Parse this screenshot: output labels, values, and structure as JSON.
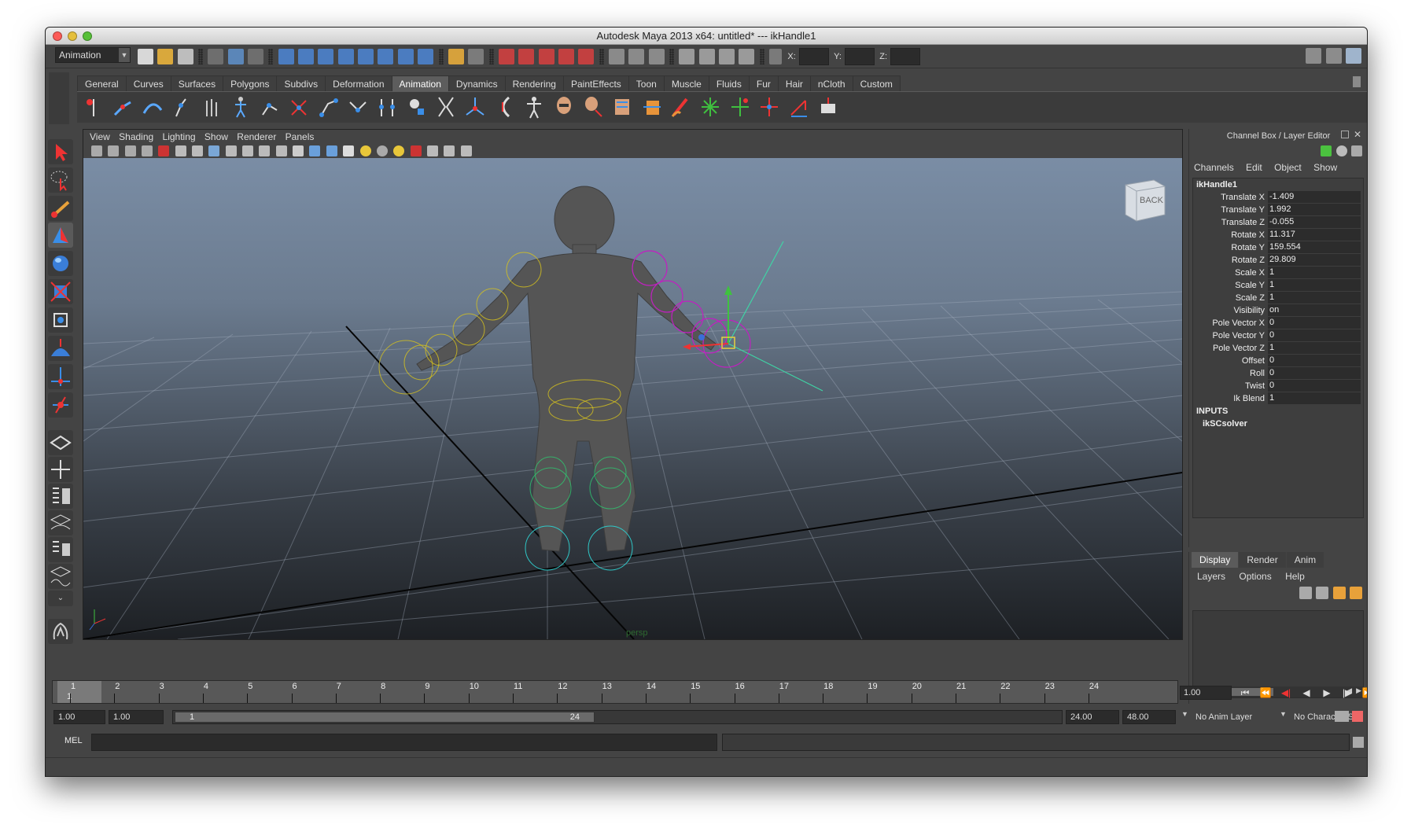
{
  "window": {
    "title": "Autodesk Maya 2013 x64: untitled*   ---   ikHandle1"
  },
  "status_line": {
    "mode_menu": "Animation",
    "x_label": "X:",
    "y_label": "Y:",
    "z_label": "Z:"
  },
  "shelf_tabs": [
    {
      "label": "General"
    },
    {
      "label": "Curves"
    },
    {
      "label": "Surfaces"
    },
    {
      "label": "Polygons"
    },
    {
      "label": "Subdivs"
    },
    {
      "label": "Deformation"
    },
    {
      "label": "Animation",
      "active": true
    },
    {
      "label": "Dynamics"
    },
    {
      "label": "Rendering"
    },
    {
      "label": "PaintEffects"
    },
    {
      "label": "Toon"
    },
    {
      "label": "Muscle"
    },
    {
      "label": "Fluids"
    },
    {
      "label": "Fur"
    },
    {
      "label": "Hair"
    },
    {
      "label": "nCloth"
    },
    {
      "label": "Custom"
    }
  ],
  "viewport": {
    "menu": [
      "View",
      "Shading",
      "Lighting",
      "Show",
      "Renderer",
      "Panels"
    ],
    "camera_label": "persp",
    "viewcube_label": "BACK"
  },
  "channel_box": {
    "header": "Channel Box / Layer Editor",
    "menu": [
      "Channels",
      "Edit",
      "Object",
      "Show"
    ],
    "object_name": "ikHandle1",
    "channels": [
      {
        "label": "Translate X",
        "value": "-1.409"
      },
      {
        "label": "Translate Y",
        "value": "1.992"
      },
      {
        "label": "Translate Z",
        "value": "-0.055"
      },
      {
        "label": "Rotate X",
        "value": "11.317"
      },
      {
        "label": "Rotate Y",
        "value": "159.554"
      },
      {
        "label": "Rotate Z",
        "value": "29.809"
      },
      {
        "label": "Scale X",
        "value": "1"
      },
      {
        "label": "Scale Y",
        "value": "1"
      },
      {
        "label": "Scale Z",
        "value": "1"
      },
      {
        "label": "Visibility",
        "value": "on"
      },
      {
        "label": "Pole Vector X",
        "value": "0"
      },
      {
        "label": "Pole Vector Y",
        "value": "0"
      },
      {
        "label": "Pole Vector Z",
        "value": "1"
      },
      {
        "label": "Offset",
        "value": "0"
      },
      {
        "label": "Roll",
        "value": "0"
      },
      {
        "label": "Twist",
        "value": "0"
      },
      {
        "label": "Ik Blend",
        "value": "1"
      }
    ],
    "inputs_header": "INPUTS",
    "input_node": "ikSCsolver"
  },
  "layer_editor": {
    "tabs": [
      {
        "label": "Display",
        "active": true
      },
      {
        "label": "Render"
      },
      {
        "label": "Anim"
      }
    ],
    "menu": [
      "Layers",
      "Options",
      "Help"
    ]
  },
  "time_slider": {
    "ticks": [
      "1",
      "2",
      "3",
      "4",
      "5",
      "6",
      "7",
      "8",
      "9",
      "10",
      "11",
      "12",
      "13",
      "14",
      "15",
      "16",
      "17",
      "18",
      "19",
      "20",
      "21",
      "22",
      "23",
      "24"
    ],
    "current_marker": "1",
    "current_frame": "1.00"
  },
  "range_slider": {
    "start_time": "1.00",
    "playback_start": "1.00",
    "knob_start": "1",
    "knob_end": "24",
    "playback_end": "24.00",
    "end_time": "48.00",
    "anim_layer": "No Anim Layer",
    "character_set": "No Character Set"
  },
  "command_line": {
    "label": "MEL"
  },
  "colors": {
    "bg": "#444444",
    "field": "#2b2b2b",
    "accent_blue": "#2f6fc0",
    "joint_yellow": "#d6c21e",
    "joint_magenta": "#c020c0",
    "joint_cyan": "#2fc7c7"
  }
}
